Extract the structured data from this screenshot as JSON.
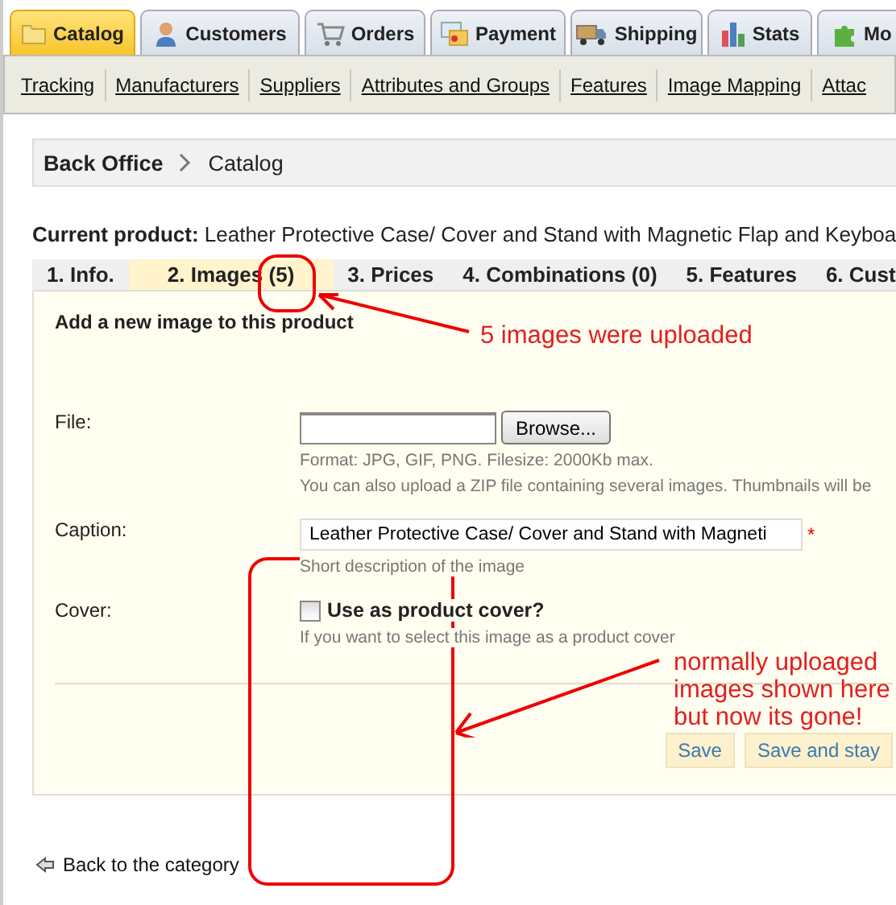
{
  "main_tabs": [
    {
      "label": "Catalog",
      "selected": true
    },
    {
      "label": "Customers",
      "selected": false
    },
    {
      "label": "Orders",
      "selected": false
    },
    {
      "label": "Payment",
      "selected": false
    },
    {
      "label": "Shipping",
      "selected": false
    },
    {
      "label": "Stats",
      "selected": false
    },
    {
      "label": "Mo",
      "selected": false
    }
  ],
  "sub_nav": [
    "Tracking",
    "Manufacturers",
    "Suppliers",
    "Attributes and Groups",
    "Features",
    "Image Mapping",
    "Attac"
  ],
  "breadcrumb": [
    "Back Office",
    "Catalog"
  ],
  "current_product": {
    "label": "Current product:",
    "value": "Leather Protective Case/ Cover and Stand with Magnetic Flap and Keyboa"
  },
  "product_tabs": [
    {
      "label": "1. Info.",
      "selected": false
    },
    {
      "label": "2. Images (5)",
      "selected": true
    },
    {
      "label": "3. Prices",
      "selected": false
    },
    {
      "label": "4. Combinations (0)",
      "selected": false
    },
    {
      "label": "5. Features",
      "selected": false
    },
    {
      "label": "6. Cust",
      "selected": false
    }
  ],
  "panel": {
    "title": "Add a new image to this product",
    "fields": [
      {
        "kind": "file",
        "label": "File:",
        "button": "Browse...",
        "hints": [
          "Format: JPG, GIF, PNG. Filesize: 2000Kb max.",
          "You can also upload a ZIP file containing several images. Thumbnails will be"
        ]
      },
      {
        "kind": "text",
        "label": "Caption:",
        "value": "Leather Protective Case/ Cover and Stand with Magneti",
        "required_mark": "*",
        "hints": [
          "Short description of the image"
        ]
      },
      {
        "kind": "checkbox",
        "label": "Cover:",
        "option": "Use as product cover?",
        "checked": false,
        "hints": [
          "If you want to select this image as a product cover"
        ]
      }
    ],
    "buttons": [
      "Save",
      "Save and stay"
    ]
  },
  "back_link": "Back to the category",
  "annotations": [
    "5 images were uploaded",
    "normally uploaged images shown here but now its gone!"
  ]
}
